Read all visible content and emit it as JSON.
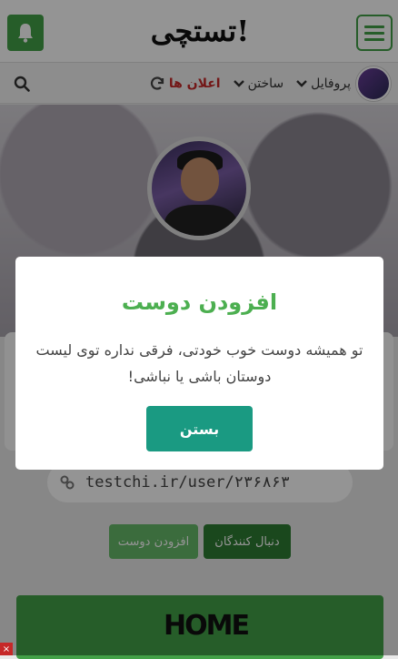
{
  "header": {
    "logo_text": "تستچی!",
    "bell_icon": "bell-icon",
    "menu_icon": "hamburger-menu-icon",
    "brand_color": "#43a047"
  },
  "nav": {
    "items": [
      {
        "label": "پروفایل",
        "icon": "chevron-down-icon"
      },
      {
        "label": "ساختن",
        "icon": "chevron-down-icon"
      },
      {
        "label": "اعلان ها",
        "icon": "refresh-icon"
      }
    ],
    "search_icon": "search-icon"
  },
  "profile": {
    "url": "testchi.ir/user/۲۳۶۸۶۳",
    "link_icon": "link-icon",
    "follow_label": "دنبال کنندگان",
    "add_friend_label": "افزودن دوست"
  },
  "banner": {
    "logo_text": "HOME"
  },
  "modal": {
    "title": "افزودن دوست",
    "message": "تو همیشه دوست خوب خودتی، فرقی نداره توی لیست دوستان باشی یا نباشی!",
    "close_label": "بستن",
    "accent_color": "#4caf50",
    "button_color": "#1a9a82"
  },
  "corner_close": "×"
}
